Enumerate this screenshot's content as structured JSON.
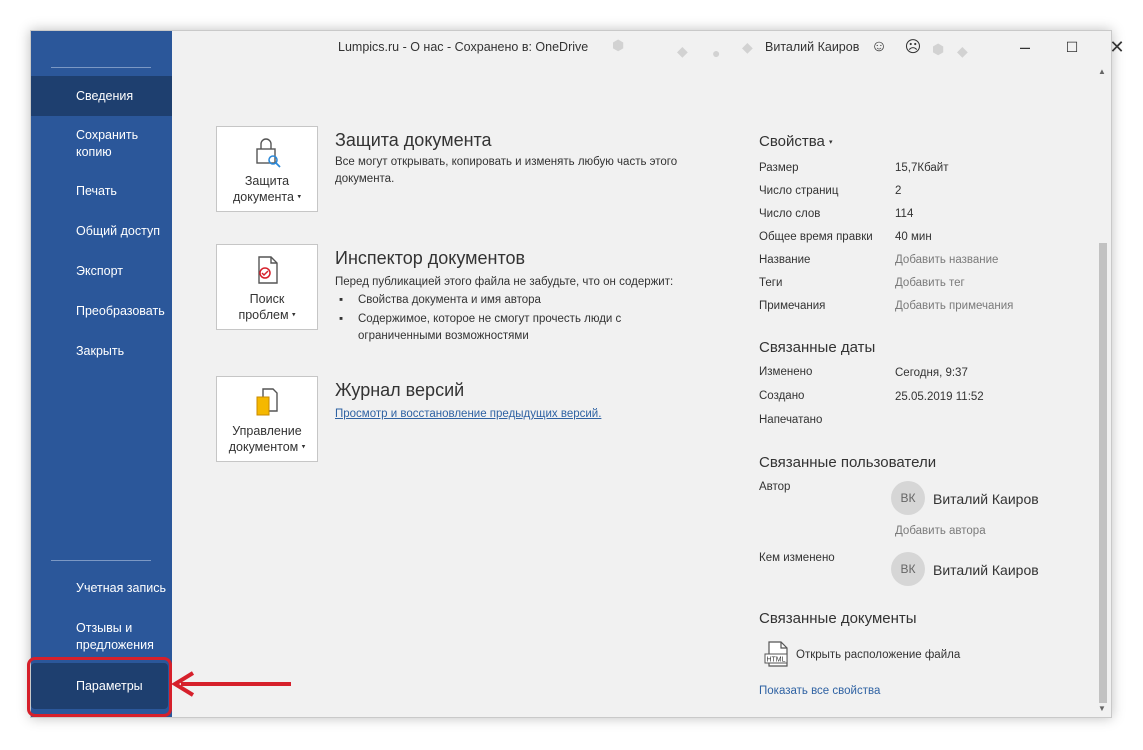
{
  "window": {
    "title": "Lumpics.ru - О нас  -  Сохранено в: OneDrive",
    "user_name": "Виталий Каиров",
    "icons": [
      "smile-icon",
      "frown-icon",
      "minimize-icon",
      "maximize-icon",
      "close-icon"
    ]
  },
  "sidebar": {
    "items": [
      {
        "label": "Сведения",
        "active": true
      },
      {
        "label": "Сохранить копию"
      },
      {
        "label": "Печать"
      },
      {
        "label": "Общий доступ"
      },
      {
        "label": "Экспорт"
      },
      {
        "label": "Преобразовать"
      },
      {
        "label": "Закрыть"
      }
    ],
    "bottom_items": [
      {
        "label": "Учетная запись"
      },
      {
        "label": "Отзывы и предложения"
      },
      {
        "label": "Параметры",
        "highlighted": true
      }
    ]
  },
  "sections": {
    "protect": {
      "card_label_1": "Защита",
      "card_label_2": "документа",
      "title": "Защита документа",
      "text": "Все могут открывать, копировать и изменять любую часть этого документа."
    },
    "inspect": {
      "card_label_1": "Поиск",
      "card_label_2": "проблем",
      "title": "Инспектор документов",
      "text": "Перед публикацией этого файла не забудьте, что он содержит:",
      "bullets": [
        "Свойства документа и имя автора",
        "Содержимое, которое не смогут прочесть люди с ограниченными возможностями"
      ]
    },
    "versions": {
      "card_label_1": "Управление",
      "card_label_2": "документом",
      "title": "Журнал версий",
      "link": "Просмотр и восстановление предыдущих версий."
    }
  },
  "properties": {
    "heading": "Свойства",
    "rows": [
      {
        "label": "Размер",
        "value": "15,7Кбайт"
      },
      {
        "label": "Число страниц",
        "value": "2"
      },
      {
        "label": "Число слов",
        "value": "114"
      },
      {
        "label": "Общее время правки",
        "value": "40 мин"
      },
      {
        "label": "Название",
        "value": "Добавить название"
      },
      {
        "label": "Теги",
        "value": "Добавить тег"
      },
      {
        "label": "Примечания",
        "value": "Добавить примечания"
      }
    ]
  },
  "related_dates": {
    "heading": "Связанные даты",
    "rows": [
      {
        "label": "Изменено",
        "value": "Сегодня, 9:37"
      },
      {
        "label": "Создано",
        "value": "25.05.2019 11:52"
      },
      {
        "label": "Напечатано",
        "value": ""
      }
    ]
  },
  "related_people": {
    "heading": "Связанные пользователи",
    "author_label": "Автор",
    "author_initials": "ВК",
    "author_name": "Виталий Каиров",
    "add_author": "Добавить автора",
    "modified_label": "Кем изменено",
    "modified_initials": "ВК",
    "modified_name": "Виталий Каиров"
  },
  "related_docs": {
    "heading": "Связанные документы",
    "open_location": "Открыть расположение файла",
    "show_all": "Показать все свойства"
  },
  "colors": {
    "sidebar": "#2b579a",
    "sidebar_active": "#1e3f6f",
    "highlight": "#d6202b",
    "link": "#2f62a3"
  }
}
